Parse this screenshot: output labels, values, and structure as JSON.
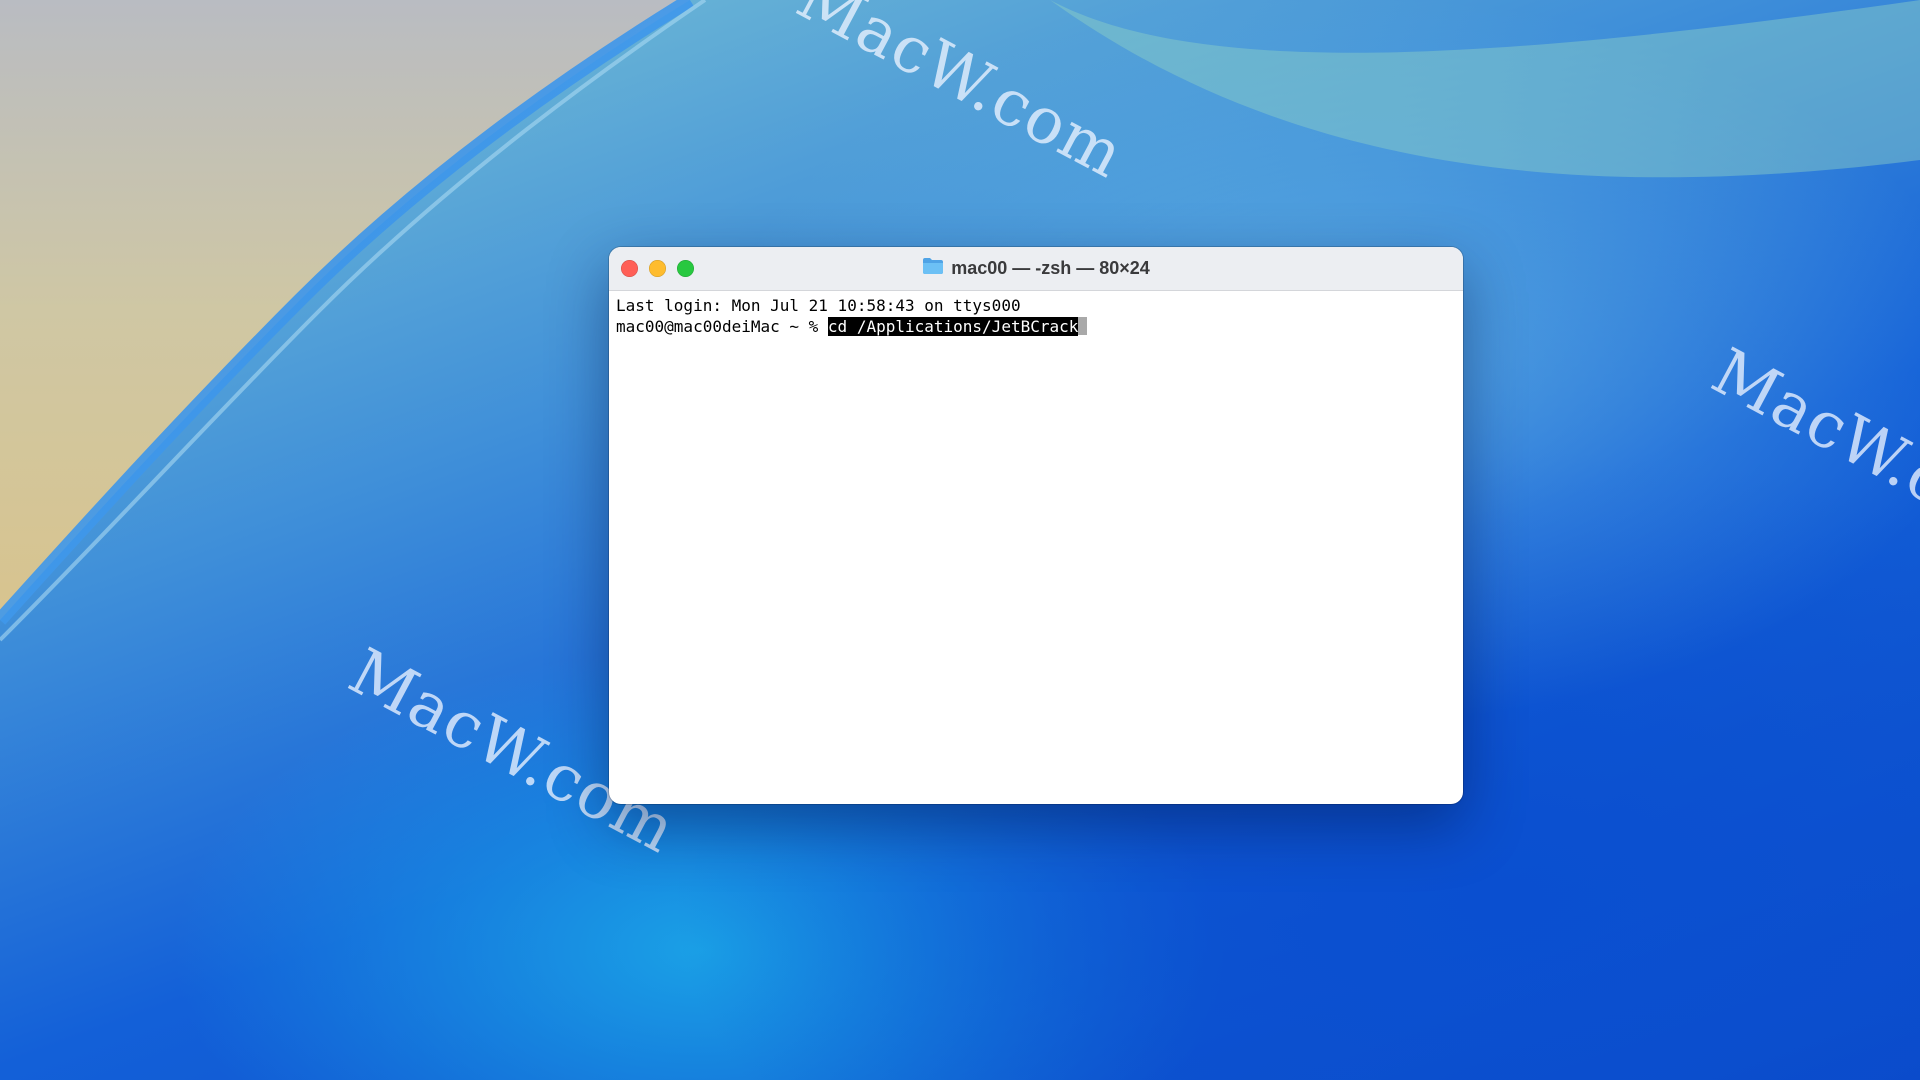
{
  "desktop": {
    "watermarks": [
      "MacW.com",
      "MacW.com",
      "MacW.com"
    ],
    "colors": {
      "sky_top_left": "#c4c2a8",
      "wave_blue": "#0b49c8",
      "highlight_teal": "#7fc7d4"
    }
  },
  "terminal": {
    "title": "mac00 — -zsh — 80×24",
    "title_icon": "folder-icon",
    "window_controls": {
      "close_color": "#ff5f57",
      "minimize_color": "#febc2e",
      "zoom_color": "#28c840"
    },
    "lines": {
      "last_login": "Last login: Mon Jul 21 10:58:43 on ttys000",
      "prompt": "mac00@mac00deiMac ~ % ",
      "command": "cd /Applications/JetBCrack"
    }
  }
}
